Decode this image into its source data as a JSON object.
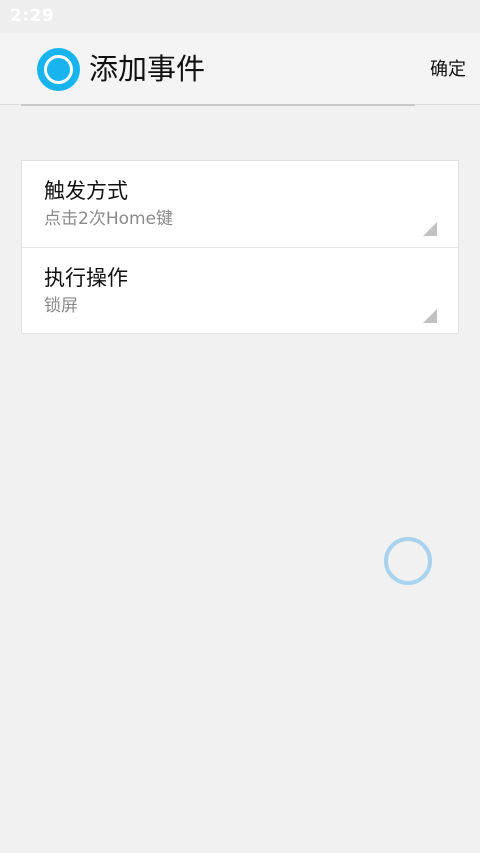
{
  "status_bar": {
    "time": "2:29"
  },
  "header": {
    "title": "添加事件",
    "confirm_label": "确定",
    "app_icon": "circle-ring-icon",
    "accent_color": "#18b4ef"
  },
  "settings": {
    "items": [
      {
        "label": "触发方式",
        "value": "点击2次Home键"
      },
      {
        "label": "执行操作",
        "value": "锁屏"
      }
    ]
  },
  "loading": {
    "icon": "loading-ring-icon",
    "color": "#a9d2ef"
  }
}
